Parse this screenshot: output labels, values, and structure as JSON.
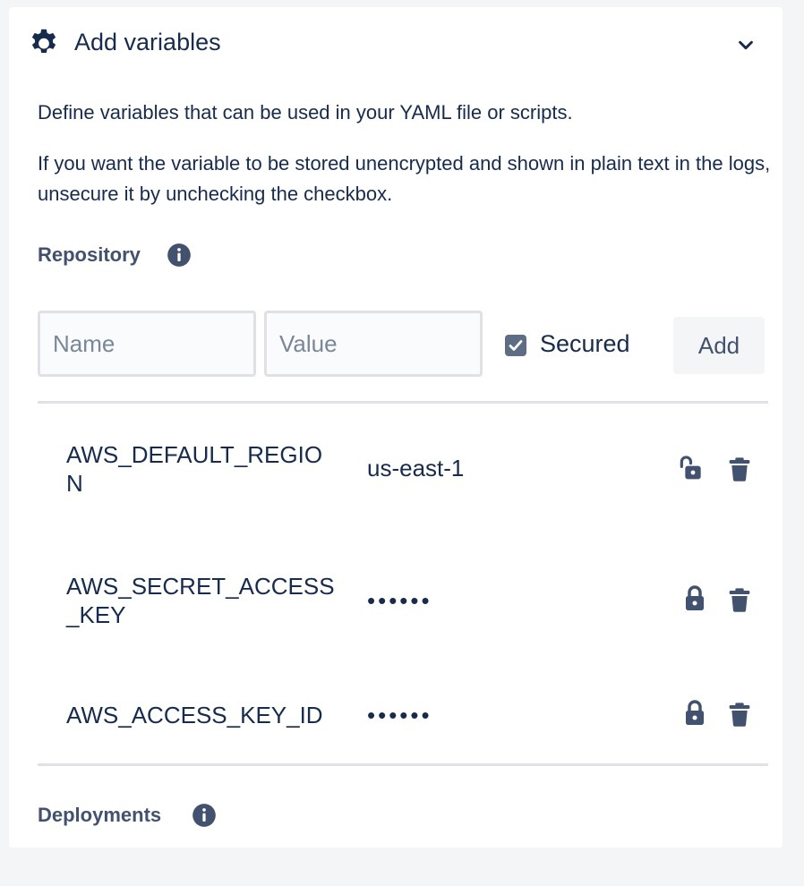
{
  "header": {
    "title": "Add variables",
    "icon": "gear-icon",
    "toggle_icon": "chevron-down-icon"
  },
  "description": {
    "line1": "Define variables that can be used in your YAML file or scripts.",
    "line2": "If you want the variable to be stored unencrypted and shown in plain text in the logs, unsecure it by unchecking the checkbox."
  },
  "repository": {
    "label": "Repository",
    "form": {
      "name_placeholder": "Name",
      "value_placeholder": "Value",
      "secured_label": "Secured",
      "secured_checked": true,
      "add_label": "Add"
    },
    "variables": [
      {
        "name": "AWS_DEFAULT_REGION",
        "value": "us-east-1",
        "secured": false
      },
      {
        "name": "AWS_SECRET_ACCESS_KEY",
        "value": "••••••",
        "secured": true
      },
      {
        "name": "AWS_ACCESS_KEY_ID",
        "value": "••••••",
        "secured": true
      }
    ]
  },
  "deployments": {
    "label": "Deployments"
  },
  "colors": {
    "text": "#172b4d",
    "muted": "#42526e",
    "icon": "#42526e",
    "divider": "#dfe1e6",
    "background": "#f4f5f7"
  }
}
